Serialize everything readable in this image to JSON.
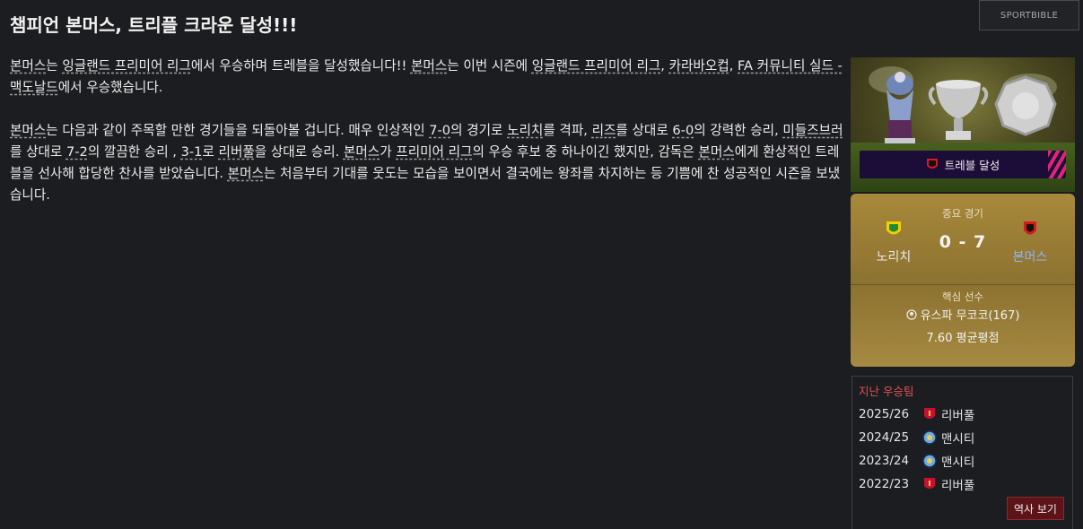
{
  "page": {
    "title": "챔피언 본머스, 트리플 크라운 달성!!!",
    "brand": "SPORTBIBLE"
  },
  "article": {
    "p1": [
      {
        "t": "본머스",
        "link": true
      },
      {
        "t": "는 ",
        "link": false
      },
      {
        "t": "잉글랜드 프리미어 리그",
        "link": true
      },
      {
        "t": "에서 우승하며 트레블을 달성했습니다!! ",
        "link": false
      },
      {
        "t": "본머스",
        "link": true
      },
      {
        "t": "는 이번 시즌에 ",
        "link": false
      },
      {
        "t": "잉글랜드 프리미어 리그",
        "link": true
      },
      {
        "t": ", ",
        "link": false
      },
      {
        "t": "카라바오컵",
        "link": true
      },
      {
        "t": ", ",
        "link": false
      },
      {
        "t": "FA 커뮤니티 실드 - 맥도날드",
        "link": true
      },
      {
        "t": "에서 우승했습니다.",
        "link": false
      }
    ],
    "p2": [
      {
        "t": "본머스",
        "link": true
      },
      {
        "t": "는 다음과 같이 주목할 만한 경기들을 되돌아볼 겁니다. 매우 인상적인 ",
        "link": false
      },
      {
        "t": "7-0",
        "link": true
      },
      {
        "t": "의 경기로 ",
        "link": false
      },
      {
        "t": "노리치",
        "link": true
      },
      {
        "t": "를 격파, ",
        "link": false
      },
      {
        "t": "리즈",
        "link": true
      },
      {
        "t": "를 상대로 ",
        "link": false
      },
      {
        "t": "6-0",
        "link": true
      },
      {
        "t": "의 강력한 승리, ",
        "link": false
      },
      {
        "t": "미들즈브러",
        "link": true
      },
      {
        "t": "를 상대로 ",
        "link": false
      },
      {
        "t": "7-2",
        "link": true
      },
      {
        "t": "의 깔끔한 승리 , ",
        "link": false
      },
      {
        "t": "3-1",
        "link": true
      },
      {
        "t": "로 ",
        "link": false
      },
      {
        "t": "리버풀",
        "link": true
      },
      {
        "t": "을 상대로 승리. ",
        "link": false
      },
      {
        "t": "본머스",
        "link": true
      },
      {
        "t": "가 ",
        "link": false
      },
      {
        "t": "프리미어 리그",
        "link": true
      },
      {
        "t": "의 우승 후보 중 하나이긴 했지만,  감독은 ",
        "link": false
      },
      {
        "t": "본머스",
        "link": true
      },
      {
        "t": "에게 환상적인 트레블을 선사해 합당한 찬사를 받았습니다. ",
        "link": false
      },
      {
        "t": "본머스",
        "link": true
      },
      {
        "t": "는 처음부터 기대를 웃도는 모습을 보이면서 결국에는 왕좌를 차지하는 등 기쁨에 찬 성공적인 시즌을 보냈습니다.",
        "link": false
      }
    ]
  },
  "banner": {
    "badge_label": "트레블 달성",
    "badge_icon": "bournemouth-crest-icon"
  },
  "match": {
    "heading": "중요 경기",
    "home_team": "노리치",
    "away_team": "본머스",
    "score": "0 - 7",
    "key_player_heading": "핵심 선수",
    "key_player": "유스파 무코코(167)",
    "rating": "7.60 평균평점"
  },
  "winners": {
    "heading": "지난 우승팀",
    "rows": [
      {
        "season": "2025/26",
        "team": "리버풀",
        "icon": "liverpool-crest-icon"
      },
      {
        "season": "2024/25",
        "team": "맨시티",
        "icon": "man-city-crest-icon"
      },
      {
        "season": "2023/24",
        "team": "맨시티",
        "icon": "man-city-crest-icon"
      },
      {
        "season": "2022/23",
        "team": "리버풀",
        "icon": "liverpool-crest-icon"
      }
    ],
    "history_button": "역사 보기"
  },
  "colors": {
    "background": "#1c1d20",
    "accent_red": "#e25151",
    "card_gold": "#a8893b",
    "link_blue": "#8fb4ff"
  }
}
